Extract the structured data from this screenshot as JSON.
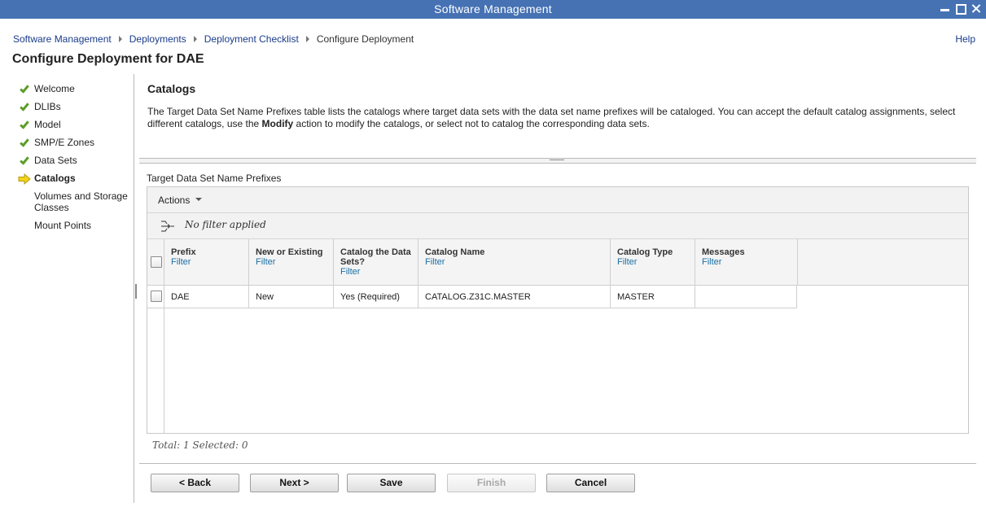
{
  "window": {
    "title": "Software Management"
  },
  "breadcrumb": {
    "items": [
      "Software Management",
      "Deployments",
      "Deployment Checklist"
    ],
    "current": "Configure Deployment"
  },
  "help_label": "Help",
  "page_title": "Configure Deployment for DAE",
  "steps": [
    {
      "label": "Welcome",
      "status": "complete"
    },
    {
      "label": "DLIBs",
      "status": "complete"
    },
    {
      "label": "Model",
      "status": "complete"
    },
    {
      "label": "SMP/E Zones",
      "status": "complete"
    },
    {
      "label": "Data Sets",
      "status": "complete"
    },
    {
      "label": "Catalogs",
      "status": "current"
    },
    {
      "label": "Volumes and Storage Classes",
      "status": "pending"
    },
    {
      "label": "Mount Points",
      "status": "pending"
    }
  ],
  "section": {
    "heading": "Catalogs",
    "desc_part1": "The Target Data Set Name Prefixes table lists the catalogs where target data sets with the data set name prefixes will be cataloged.  You can accept the default catalog assignments, select different catalogs, use the ",
    "desc_bold": "Modify",
    "desc_part2": " action to modify the catalogs, or select not to catalog the corresponding data sets."
  },
  "table": {
    "caption": "Target Data Set Name Prefixes",
    "actions_label": "Actions",
    "filter_status": "No filter applied",
    "filter_link": "Filter",
    "columns": [
      {
        "title": "Prefix"
      },
      {
        "title": "New or Existing"
      },
      {
        "title": "Catalog the Data Sets?"
      },
      {
        "title": "Catalog Name"
      },
      {
        "title": "Catalog Type"
      },
      {
        "title": "Messages"
      }
    ],
    "rows": [
      [
        "DAE",
        "New",
        "Yes (Required)",
        "CATALOG.Z31C.MASTER",
        "MASTER",
        ""
      ]
    ],
    "summary": "Total: 1 Selected: 0"
  },
  "buttons": {
    "back": "< Back",
    "next": "Next >",
    "save": "Save",
    "finish": "Finish",
    "cancel": "Cancel"
  },
  "colors": {
    "titlebar": "#4672b4",
    "link": "#1a3b8a",
    "check": "#5b9e28",
    "current_arrow": "#e8c81a"
  }
}
